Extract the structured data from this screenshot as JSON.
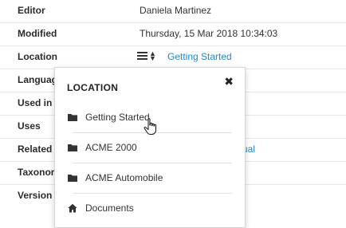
{
  "rows": [
    {
      "label": "Editor",
      "value": "Daniela Martinez"
    },
    {
      "label": "Modified",
      "value": "Thursday, 15 Mar 2018 10:34:03"
    },
    {
      "label": "Location",
      "value": "Getting Started"
    },
    {
      "label": "Languag",
      "value": ""
    },
    {
      "label": "Used in",
      "value": ""
    },
    {
      "label": "Uses",
      "value": ""
    },
    {
      "label": "Related",
      "value": "ual"
    },
    {
      "label": "Taxonor",
      "value": ""
    },
    {
      "label": "Version",
      "value": ""
    }
  ],
  "popover": {
    "title": "LOCATION",
    "close_glyph": "✖",
    "items": [
      {
        "label": "Getting Started",
        "icon": "folder-icon"
      },
      {
        "label": "ACME 2000",
        "icon": "folder-icon"
      },
      {
        "label": "ACME Automobile",
        "icon": "folder-icon"
      },
      {
        "label": "Documents",
        "icon": "home-icon"
      }
    ]
  },
  "colors": {
    "link": "#1a8bd4",
    "border": "#e6e6e6"
  }
}
